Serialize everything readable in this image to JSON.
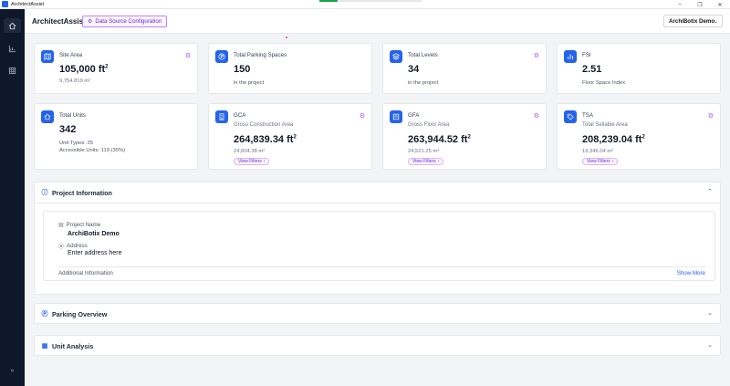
{
  "window": {
    "title": "ArchitectAssist"
  },
  "header": {
    "app_title": "ArchitectAssist",
    "data_source_button": "Data Source Configuration",
    "project_select": "ArchiBotix Demo"
  },
  "cards": {
    "site_area": {
      "label": "Site Area",
      "value": "105,000 ft",
      "unit_sup": "2",
      "note": "9,754.819 m²",
      "icon": "map-icon"
    },
    "parking": {
      "label": "Total Parking Spaces",
      "value": "150",
      "note": "in the project",
      "icon": "parking-icon"
    },
    "levels": {
      "label": "Total Levels",
      "value": "34",
      "note": "in the project",
      "icon": "layers-icon"
    },
    "fsi": {
      "label": "FSI",
      "value": "2.51",
      "note": "Floor Space Index",
      "icon": "chart-icon"
    },
    "units": {
      "label": "Total Units",
      "value": "342",
      "note1": "Unit Types: 25",
      "note2": "Accessible Units: 119 (35%)",
      "icon": "home-icon"
    },
    "gca": {
      "label": "GCA",
      "sub": "Gross Construction Area",
      "value": "264,839.34 ft",
      "unit_sup": "2",
      "note": "24,604.38 m²",
      "filters": "View Filters",
      "icon": "building-icon"
    },
    "gfa": {
      "label": "GFA",
      "sub": "Gross Floor Area",
      "value": "263,944.52 ft",
      "unit_sup": "2",
      "note": "24,521.25 m²",
      "filters": "View Filters",
      "icon": "floor-icon"
    },
    "tsa": {
      "label": "TSA",
      "sub": "Total Sellable Area",
      "value": "208,239.04 ft",
      "unit_sup": "2",
      "note": "19,346.04 m²",
      "filters": "View Filters",
      "icon": "tag-icon"
    }
  },
  "project_info": {
    "title": "Project Information",
    "name_label": "Project Name",
    "name_value": "ArchiBotix Demo",
    "address_label": "Address",
    "address_value": "Enter address here",
    "additional_label": "Additional Information",
    "show_more": "Show More"
  },
  "parking_overview": {
    "title": "Parking Overview"
  },
  "unit_analysis": {
    "title": "Unit Analysis"
  },
  "colors": {
    "accent": "#2563eb",
    "purple": "#a855f7",
    "rail": "#0f172a"
  }
}
